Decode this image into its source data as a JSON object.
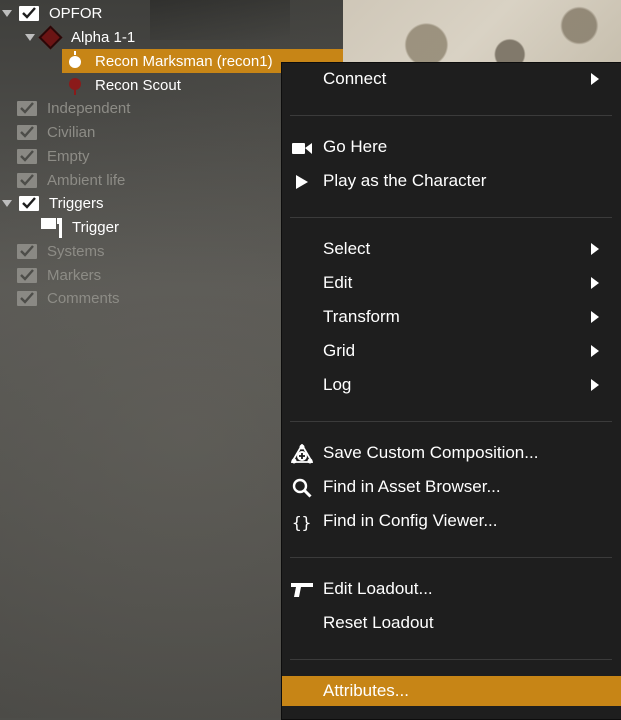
{
  "tree": {
    "opfor": "OPFOR",
    "group": "Alpha 1-1",
    "unit_selected": "Recon Marksman (recon1)",
    "unit_other": "Recon Scout",
    "independent": "Independent",
    "civilian": "Civilian",
    "empty": "Empty",
    "ambient": "Ambient life",
    "triggers": "Triggers",
    "trigger": "Trigger",
    "systems": "Systems",
    "markers": "Markers",
    "comments": "Comments"
  },
  "menu": {
    "connect": "Connect",
    "go_here": "Go Here",
    "play_as": "Play as the Character",
    "select": "Select",
    "edit": "Edit",
    "transform": "Transform",
    "grid": "Grid",
    "log": "Log",
    "save_composition": "Save Custom Composition...",
    "find_asset": "Find in Asset Browser...",
    "find_config": "Find in Config Viewer...",
    "edit_loadout": "Edit Loadout...",
    "reset_loadout": "Reset Loadout",
    "attributes": "Attributes..."
  },
  "colors": {
    "accent": "#c78516",
    "menu_bg": "#1e1e1e",
    "opfor_red": "#8b1a1a"
  }
}
